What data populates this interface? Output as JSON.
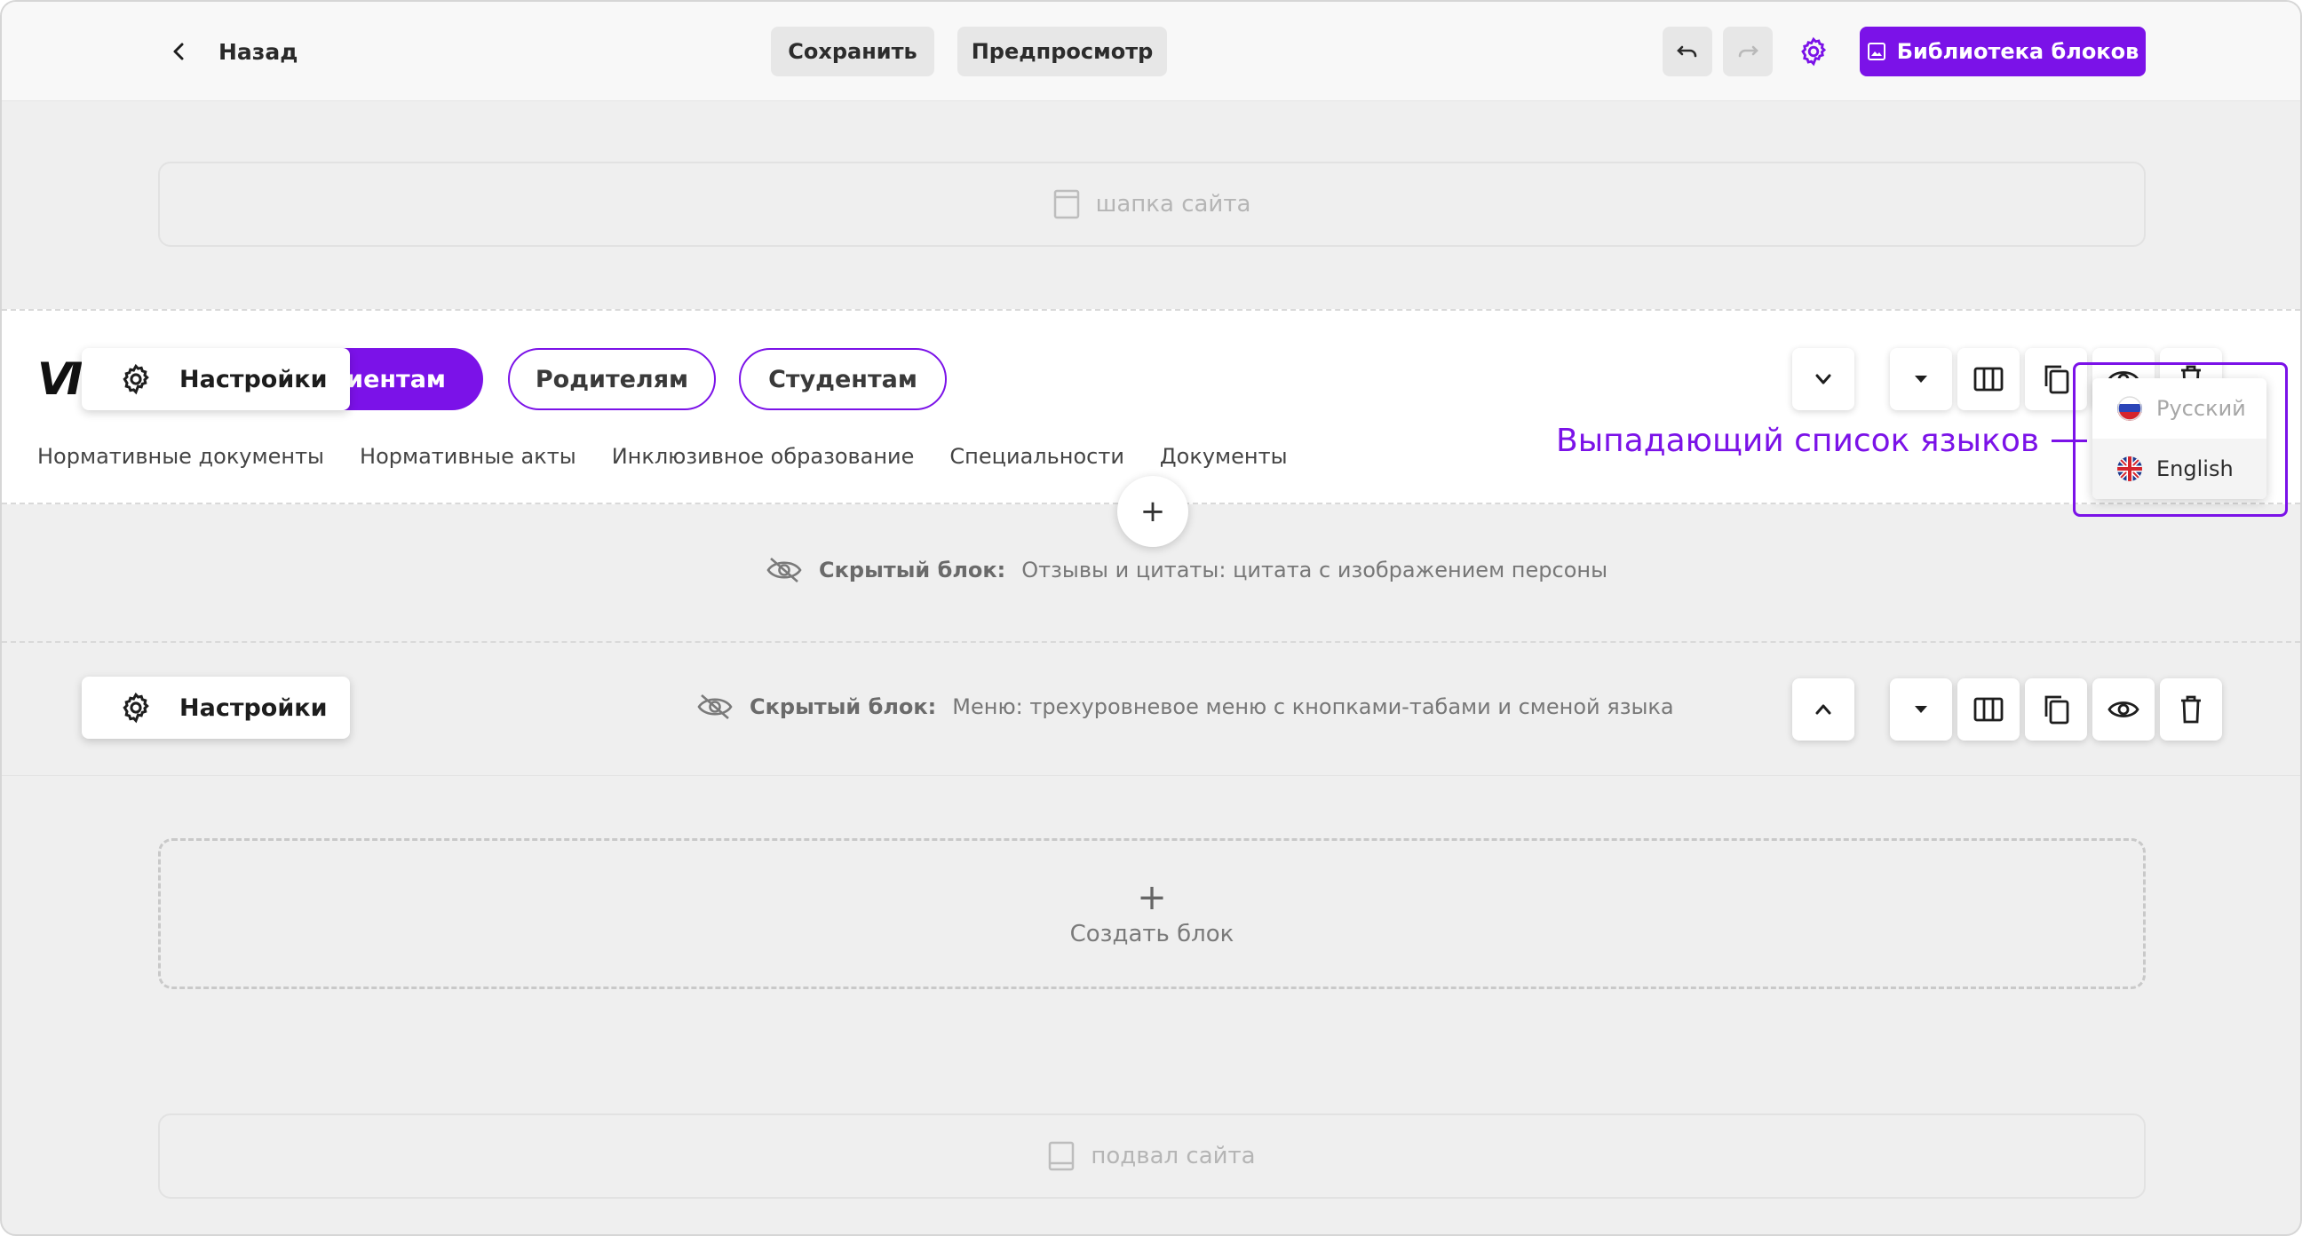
{
  "toolbar": {
    "back_label": "Назад",
    "save_label": "Сохранить",
    "preview_label": "Предпросмотр",
    "library_label": "Библиотека блоков"
  },
  "site_header": {
    "label": "шапка сайта"
  },
  "site_footer": {
    "label": "подвал сайта"
  },
  "menu_block": {
    "settings_label": "Настройки",
    "tabs": [
      {
        "label": "иентам",
        "active": true
      },
      {
        "label": "Родителям",
        "active": false
      },
      {
        "label": "Студентам",
        "active": false
      }
    ],
    "nav_links": [
      "Нормативные документы",
      "Нормативные акты",
      "Инклюзивное образование",
      "Специальности",
      "Документы"
    ]
  },
  "language_dropdown": {
    "annotation": "Выпадающий список языков",
    "options": [
      {
        "label": "Русский",
        "selected": false
      },
      {
        "label": "English",
        "selected": true
      }
    ]
  },
  "hidden_block_1": {
    "prefix": "Скрытый блок:",
    "description": "Отзывы и цитаты: цитата с изображением персоны"
  },
  "hidden_block_2": {
    "settings_label": "Настройки",
    "prefix": "Скрытый блок:",
    "description": "Меню: трехуровневое меню с кнопками-табами и сменой языка"
  },
  "create_block": {
    "label": "Создать блок"
  },
  "colors": {
    "accent": "#7b12e8",
    "background": "#efefef"
  }
}
